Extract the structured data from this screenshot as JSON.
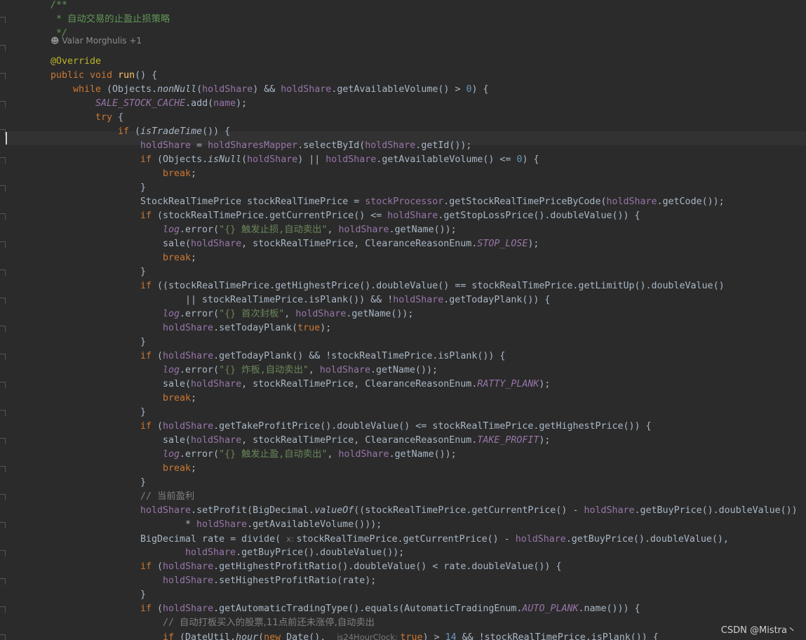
{
  "editor": {
    "author_hint": "Valar Morghulis +1",
    "watermark": "CSDN @Mistra丶"
  },
  "lines": [
    {
      "indent": 0,
      "tokens": [
        {
          "t": "    /**",
          "c": "comment-doc"
        }
      ]
    },
    {
      "indent": 0,
      "tokens": [
        {
          "t": "     * ",
          "c": "comment-doc"
        },
        {
          "t": "自动交易的止盈止损策略",
          "c": "comment-doc cn-comment"
        }
      ]
    },
    {
      "indent": 0,
      "tokens": [
        {
          "t": "     */",
          "c": "comment-doc"
        }
      ]
    },
    {
      "indent": 0,
      "tokens": []
    },
    {
      "indent": 0,
      "tokens": [
        {
          "t": "@Override",
          "c": "annotation"
        }
      ]
    },
    {
      "indent": 0,
      "tokens": [
        {
          "t": "public void ",
          "c": "keyword"
        },
        {
          "t": "run",
          "c": "method-decl"
        },
        {
          "t": "() {",
          "c": "plain"
        }
      ]
    },
    {
      "indent": 1,
      "tokens": [
        {
          "t": "while ",
          "c": "keyword"
        },
        {
          "t": "(Objects.",
          "c": "plain"
        },
        {
          "t": "nonNull",
          "c": "static-call"
        },
        {
          "t": "(",
          "c": "plain"
        },
        {
          "t": "holdShare",
          "c": "field"
        },
        {
          "t": ") && ",
          "c": "plain"
        },
        {
          "t": "holdShare",
          "c": "field"
        },
        {
          "t": ".getAvailableVolume() > ",
          "c": "plain"
        },
        {
          "t": "0",
          "c": "number"
        },
        {
          "t": ") {",
          "c": "plain"
        }
      ]
    },
    {
      "indent": 2,
      "tokens": [
        {
          "t": "SALE_STOCK_CACHE",
          "c": "static-field"
        },
        {
          "t": ".add(",
          "c": "plain"
        },
        {
          "t": "name",
          "c": "field"
        },
        {
          "t": ");",
          "c": "plain"
        }
      ]
    },
    {
      "indent": 2,
      "tokens": [
        {
          "t": "try ",
          "c": "keyword"
        },
        {
          "t": "{",
          "c": "plain"
        }
      ]
    },
    {
      "indent": 3,
      "tokens": [
        {
          "t": "if ",
          "c": "keyword"
        },
        {
          "t": "(",
          "c": "plain"
        },
        {
          "t": "isTradeTime",
          "c": "static-call"
        },
        {
          "t": "()) {",
          "c": "plain"
        }
      ]
    },
    {
      "indent": 4,
      "tokens": [
        {
          "t": "holdShare",
          "c": "field"
        },
        {
          "t": " = ",
          "c": "plain"
        },
        {
          "t": "holdSharesMapper",
          "c": "field"
        },
        {
          "t": ".selectById(",
          "c": "plain"
        },
        {
          "t": "holdShare",
          "c": "field"
        },
        {
          "t": ".getId());",
          "c": "plain"
        }
      ]
    },
    {
      "indent": 4,
      "tokens": [
        {
          "t": "if ",
          "c": "keyword"
        },
        {
          "t": "(Objects.",
          "c": "plain"
        },
        {
          "t": "isNull",
          "c": "static-call"
        },
        {
          "t": "(",
          "c": "plain"
        },
        {
          "t": "holdShare",
          "c": "field"
        },
        {
          "t": ") || ",
          "c": "plain"
        },
        {
          "t": "holdShare",
          "c": "field"
        },
        {
          "t": ".getAvailableVolume() <= ",
          "c": "plain"
        },
        {
          "t": "0",
          "c": "number"
        },
        {
          "t": ") {",
          "c": "plain"
        }
      ]
    },
    {
      "indent": 5,
      "tokens": [
        {
          "t": "break",
          "c": "keyword"
        },
        {
          "t": ";",
          "c": "plain"
        }
      ]
    },
    {
      "indent": 4,
      "tokens": [
        {
          "t": "}",
          "c": "plain"
        }
      ]
    },
    {
      "indent": 4,
      "tokens": [
        {
          "t": "StockRealTimePrice stockRealTimePrice = ",
          "c": "plain"
        },
        {
          "t": "stockProcessor",
          "c": "field"
        },
        {
          "t": ".getStockRealTimePriceByCode(",
          "c": "plain"
        },
        {
          "t": "holdShare",
          "c": "field"
        },
        {
          "t": ".getCode());",
          "c": "plain"
        }
      ]
    },
    {
      "indent": 4,
      "tokens": [
        {
          "t": "if ",
          "c": "keyword"
        },
        {
          "t": "(stockRealTimePrice.getCurrentPrice() <= ",
          "c": "plain"
        },
        {
          "t": "holdShare",
          "c": "field"
        },
        {
          "t": ".getStopLossPrice().doubleValue()) {",
          "c": "plain"
        }
      ]
    },
    {
      "indent": 5,
      "tokens": [
        {
          "t": "log",
          "c": "static-field"
        },
        {
          "t": ".error(",
          "c": "plain"
        },
        {
          "t": "\"{} 触发止损,自动卖出\"",
          "c": "string"
        },
        {
          "t": ", ",
          "c": "plain"
        },
        {
          "t": "holdShare",
          "c": "field"
        },
        {
          "t": ".getName());",
          "c": "plain"
        }
      ]
    },
    {
      "indent": 5,
      "tokens": [
        {
          "t": "sale(",
          "c": "plain"
        },
        {
          "t": "holdShare",
          "c": "field"
        },
        {
          "t": ", stockRealTimePrice, ClearanceReasonEnum.",
          "c": "plain"
        },
        {
          "t": "STOP_LOSE",
          "c": "static-field"
        },
        {
          "t": ");",
          "c": "plain"
        }
      ]
    },
    {
      "indent": 5,
      "tokens": [
        {
          "t": "break",
          "c": "keyword"
        },
        {
          "t": ";",
          "c": "plain"
        }
      ]
    },
    {
      "indent": 4,
      "tokens": [
        {
          "t": "}",
          "c": "plain"
        }
      ]
    },
    {
      "indent": 4,
      "tokens": [
        {
          "t": "if ",
          "c": "keyword"
        },
        {
          "t": "((stockRealTimePrice.getHighestPrice().doubleValue() == stockRealTimePrice.getLimitUp().doubleValue()",
          "c": "plain"
        }
      ]
    },
    {
      "indent": 6,
      "tokens": [
        {
          "t": "|| stockRealTimePrice.isPlank()) && !",
          "c": "plain"
        },
        {
          "t": "holdShare",
          "c": "field"
        },
        {
          "t": ".getTodayPlank()) {",
          "c": "plain"
        }
      ]
    },
    {
      "indent": 5,
      "tokens": [
        {
          "t": "log",
          "c": "static-field"
        },
        {
          "t": ".error(",
          "c": "plain"
        },
        {
          "t": "\"{} 首次封板\"",
          "c": "string"
        },
        {
          "t": ", ",
          "c": "plain"
        },
        {
          "t": "holdShare",
          "c": "field"
        },
        {
          "t": ".getName());",
          "c": "plain"
        }
      ]
    },
    {
      "indent": 5,
      "tokens": [
        {
          "t": "holdShare",
          "c": "field"
        },
        {
          "t": ".setTodayPlank(",
          "c": "plain"
        },
        {
          "t": "true",
          "c": "keyword"
        },
        {
          "t": ");",
          "c": "plain"
        }
      ]
    },
    {
      "indent": 4,
      "tokens": [
        {
          "t": "}",
          "c": "plain"
        }
      ]
    },
    {
      "indent": 4,
      "tokens": [
        {
          "t": "if ",
          "c": "keyword"
        },
        {
          "t": "(",
          "c": "plain"
        },
        {
          "t": "holdShare",
          "c": "field"
        },
        {
          "t": ".getTodayPlank() && !stockRealTimePrice.isPlank()) {",
          "c": "plain"
        }
      ]
    },
    {
      "indent": 5,
      "tokens": [
        {
          "t": "log",
          "c": "static-field"
        },
        {
          "t": ".error(",
          "c": "plain"
        },
        {
          "t": "\"{} 炸板,自动卖出\"",
          "c": "string"
        },
        {
          "t": ", ",
          "c": "plain"
        },
        {
          "t": "holdShare",
          "c": "field"
        },
        {
          "t": ".getName());",
          "c": "plain"
        }
      ]
    },
    {
      "indent": 5,
      "tokens": [
        {
          "t": "sale(",
          "c": "plain"
        },
        {
          "t": "holdShare",
          "c": "field"
        },
        {
          "t": ", stockRealTimePrice, ClearanceReasonEnum.",
          "c": "plain"
        },
        {
          "t": "RATTY_PLANK",
          "c": "static-field"
        },
        {
          "t": ");",
          "c": "plain"
        }
      ]
    },
    {
      "indent": 5,
      "tokens": [
        {
          "t": "break",
          "c": "keyword"
        },
        {
          "t": ";",
          "c": "plain"
        }
      ]
    },
    {
      "indent": 4,
      "tokens": [
        {
          "t": "}",
          "c": "plain"
        }
      ]
    },
    {
      "indent": 4,
      "tokens": [
        {
          "t": "if ",
          "c": "keyword"
        },
        {
          "t": "(",
          "c": "plain"
        },
        {
          "t": "holdShare",
          "c": "field"
        },
        {
          "t": ".getTakeProfitPrice().doubleValue() <= stockRealTimePrice.getHighestPrice()) {",
          "c": "plain"
        }
      ]
    },
    {
      "indent": 5,
      "tokens": [
        {
          "t": "sale(",
          "c": "plain"
        },
        {
          "t": "holdShare",
          "c": "field"
        },
        {
          "t": ", stockRealTimePrice, ClearanceReasonEnum.",
          "c": "plain"
        },
        {
          "t": "TAKE_PROFIT",
          "c": "static-field"
        },
        {
          "t": ");",
          "c": "plain"
        }
      ]
    },
    {
      "indent": 5,
      "tokens": [
        {
          "t": "log",
          "c": "static-field"
        },
        {
          "t": ".error(",
          "c": "plain"
        },
        {
          "t": "\"{} 触发止盈,自动卖出\"",
          "c": "string"
        },
        {
          "t": ", ",
          "c": "plain"
        },
        {
          "t": "holdShare",
          "c": "field"
        },
        {
          "t": ".getName());",
          "c": "plain"
        }
      ]
    },
    {
      "indent": 5,
      "tokens": [
        {
          "t": "break",
          "c": "keyword"
        },
        {
          "t": ";",
          "c": "plain"
        }
      ]
    },
    {
      "indent": 4,
      "tokens": [
        {
          "t": "}",
          "c": "plain"
        }
      ]
    },
    {
      "indent": 4,
      "tokens": [
        {
          "t": "// ",
          "c": "comment"
        },
        {
          "t": "当前盈利",
          "c": "comment cn-comment"
        }
      ]
    },
    {
      "indent": 4,
      "tokens": [
        {
          "t": "holdShare",
          "c": "field"
        },
        {
          "t": ".setProfit(BigDecimal.",
          "c": "plain"
        },
        {
          "t": "valueOf",
          "c": "static-call"
        },
        {
          "t": "((stockRealTimePrice.getCurrentPrice() - ",
          "c": "plain"
        },
        {
          "t": "holdShare",
          "c": "field"
        },
        {
          "t": ".getBuyPrice().doubleValue())",
          "c": "plain"
        }
      ]
    },
    {
      "indent": 6,
      "tokens": [
        {
          "t": "* ",
          "c": "plain"
        },
        {
          "t": "holdShare",
          "c": "field"
        },
        {
          "t": ".getAvailableVolume()));",
          "c": "plain"
        }
      ]
    },
    {
      "indent": 4,
      "tokens": [
        {
          "t": "BigDecimal rate = divide( ",
          "c": "plain"
        },
        {
          "t": "x: ",
          "c": "hint"
        },
        {
          "t": "stockRealTimePrice.getCurrentPrice() - ",
          "c": "plain"
        },
        {
          "t": "holdShare",
          "c": "field"
        },
        {
          "t": ".getBuyPrice().doubleValue(),",
          "c": "plain"
        }
      ]
    },
    {
      "indent": 6,
      "tokens": [
        {
          "t": "holdShare",
          "c": "field"
        },
        {
          "t": ".getBuyPrice().doubleValue());",
          "c": "plain"
        }
      ]
    },
    {
      "indent": 4,
      "tokens": [
        {
          "t": "if ",
          "c": "keyword"
        },
        {
          "t": "(",
          "c": "plain"
        },
        {
          "t": "holdShare",
          "c": "field"
        },
        {
          "t": ".getHighestProfitRatio().doubleValue() < rate.doubleValue()) {",
          "c": "plain"
        }
      ]
    },
    {
      "indent": 5,
      "tokens": [
        {
          "t": "holdShare",
          "c": "field"
        },
        {
          "t": ".setHighestProfitRatio(rate);",
          "c": "plain"
        }
      ]
    },
    {
      "indent": 4,
      "tokens": [
        {
          "t": "}",
          "c": "plain"
        }
      ]
    },
    {
      "indent": 4,
      "tokens": [
        {
          "t": "if ",
          "c": "keyword"
        },
        {
          "t": "(",
          "c": "plain"
        },
        {
          "t": "holdShare",
          "c": "field"
        },
        {
          "t": ".getAutomaticTradingType().equals(AutomaticTradingEnum.",
          "c": "plain"
        },
        {
          "t": "AUTO_PLANK",
          "c": "static-field"
        },
        {
          "t": ".name())) {",
          "c": "plain"
        }
      ]
    },
    {
      "indent": 5,
      "tokens": [
        {
          "t": "// ",
          "c": "comment"
        },
        {
          "t": "自动打板买入的股票,11点前还未涨停,自动卖出",
          "c": "comment cn-comment"
        }
      ]
    },
    {
      "indent": 5,
      "tokens": [
        {
          "t": "if ",
          "c": "keyword"
        },
        {
          "t": "(DateUtil.",
          "c": "plain"
        },
        {
          "t": "hour",
          "c": "static-call"
        },
        {
          "t": "(",
          "c": "plain"
        },
        {
          "t": "new ",
          "c": "keyword"
        },
        {
          "t": "Date(),  ",
          "c": "plain"
        },
        {
          "t": "is24HourClock: ",
          "c": "hint"
        },
        {
          "t": "true",
          "c": "keyword"
        },
        {
          "t": ") > ",
          "c": "plain"
        },
        {
          "t": "14",
          "c": "number"
        },
        {
          "t": " && !stockRealTimePrice.isPlank()) {",
          "c": "plain"
        }
      ]
    }
  ]
}
